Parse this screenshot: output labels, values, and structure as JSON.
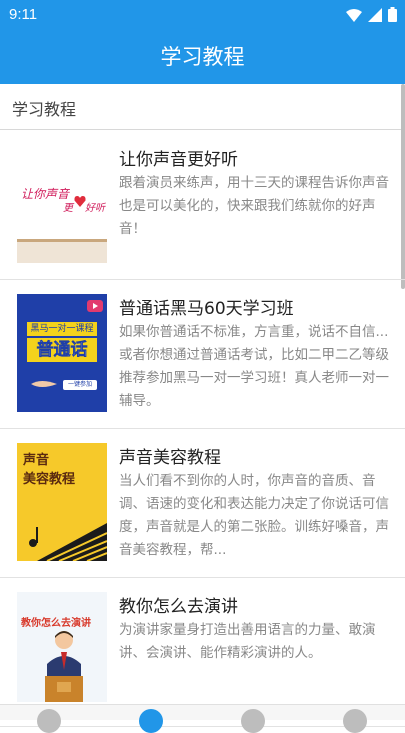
{
  "status_bar": {
    "time": "9:11"
  },
  "app_bar": {
    "title": "学习教程"
  },
  "section": {
    "title": "学习教程"
  },
  "courses": [
    {
      "title": "让你声音更好听",
      "description": "跟着演员来练声，用十三天的课程告诉你声音也是可以美化的，快来跟我们练就你的好声音！",
      "thumb_text": [
        "让你声音",
        "更",
        "好听"
      ]
    },
    {
      "title": "普通话黑马60天学习班",
      "description": "如果你普通话不标准，方言重，说话不自信... 或者你想通过普通话考试，比如二甲二乙等级 推荐参加黑马一对一学习班！真人老师一对一辅导。",
      "thumb_text": [
        "黑马一对一课程",
        "普通话",
        "一键参加"
      ]
    },
    {
      "title": "声音美容教程",
      "description": "当人们看不到你的人时，你声音的音质、音调、语速的变化和表达能力决定了你说话可信度，声音就是人的第二张脸。训练好嗓音，声音美容教程，帮...",
      "thumb_text": [
        "声音",
        "美容教程"
      ]
    },
    {
      "title": "教你怎么去演讲",
      "description": "为演讲家量身打造出善用语言的力量、敢演讲、会演讲、能作精彩演讲的人。",
      "thumb_text": [
        "教你怎么去演讲"
      ]
    }
  ],
  "colors": {
    "primary": "#2196e8"
  },
  "bottom_nav": {
    "icons": [
      "home-icon",
      "tutorial-icon",
      "book-icon",
      "profile-icon"
    ]
  }
}
